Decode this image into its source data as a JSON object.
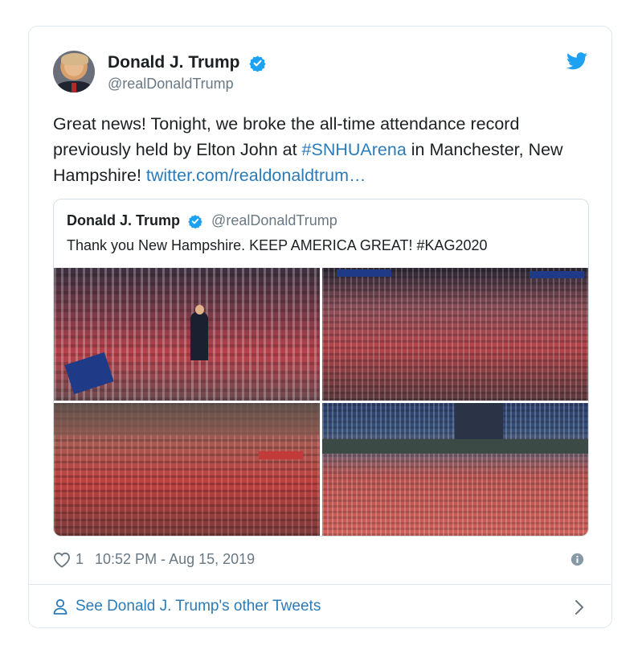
{
  "tweet": {
    "author_name": "Donald J. Trump",
    "author_handle": "@realDonaldTrump",
    "text_part1": "Great news! Tonight, we broke the all-time attendance record previously held by Elton John at ",
    "hashtag": "#SNHUArena",
    "text_part2": " in Manchester, New Hampshire! ",
    "link": "twitter.com/realdonaldtrum…",
    "like_count": "1",
    "timestamp": "10:52 PM - Aug 15, 2019"
  },
  "quoted_tweet": {
    "author_name": "Donald J. Trump",
    "author_handle": "@realDonaldTrump",
    "text": "Thank you New Hampshire. KEEP AMERICA GREAT! #KAG2020",
    "photos": [
      "rally-photo-stage",
      "rally-photo-crowd-arena",
      "rally-photo-arena-wide",
      "rally-photo-outdoor-crowd"
    ]
  },
  "footer": {
    "see_more_label": "See Donald J. Trump's other Tweets"
  },
  "icons": {
    "verified": "verified-badge-icon",
    "brand": "twitter-bird-icon",
    "like": "heart-icon",
    "info": "info-icon",
    "profile": "person-icon",
    "chevron": "chevron-right-icon"
  },
  "colors": {
    "link": "#2b7bb9",
    "verified": "#1da1f2",
    "secondary_text": "#697882",
    "border": "#e1e8ed"
  }
}
